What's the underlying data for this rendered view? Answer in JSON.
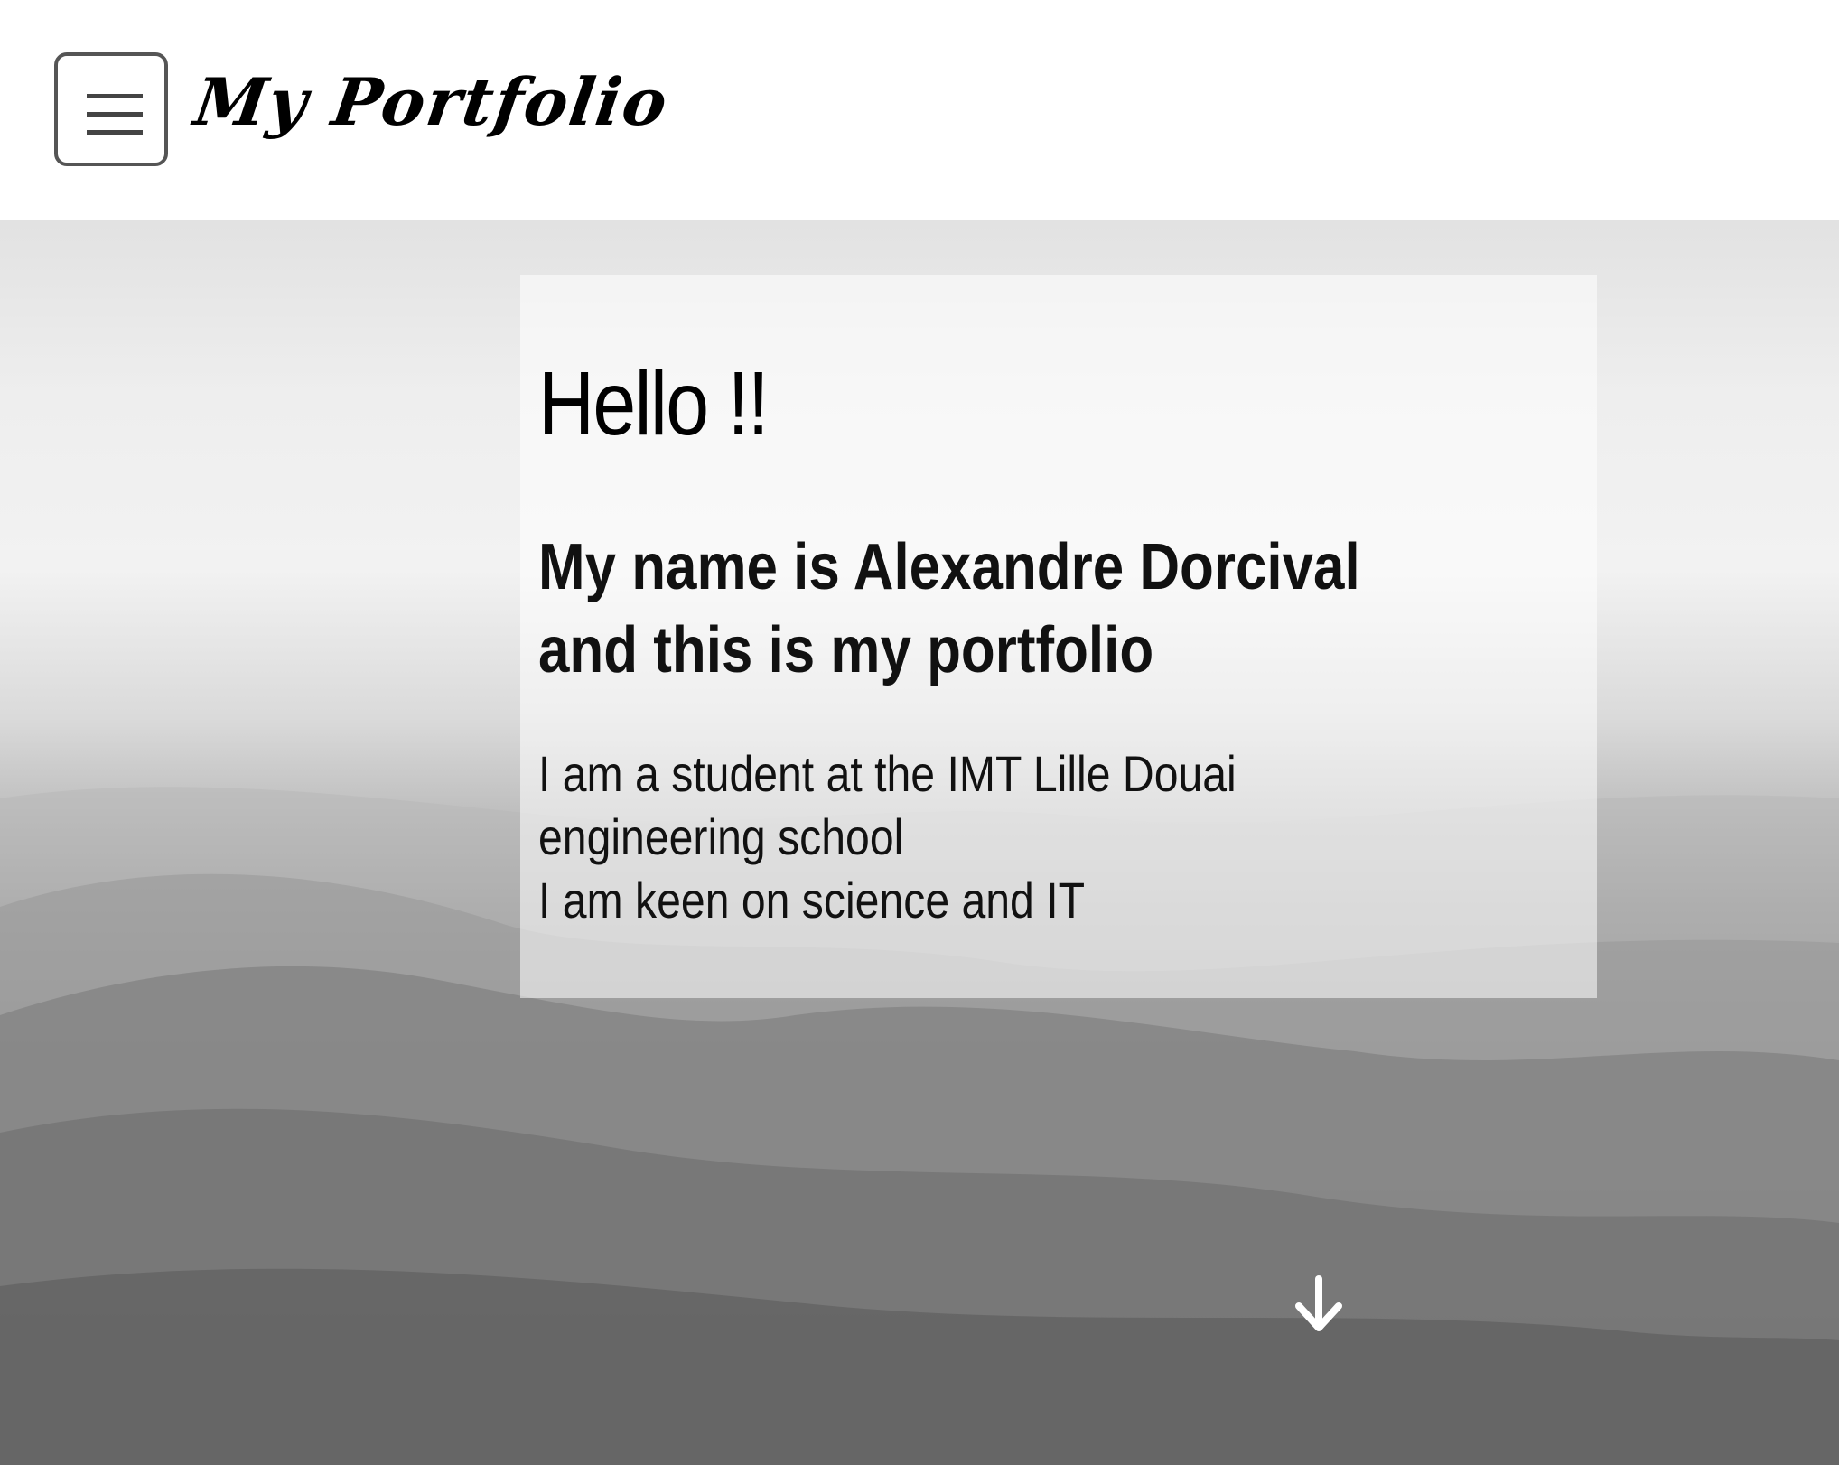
{
  "header": {
    "brand_title": "My Portfolio",
    "menu_icon": "hamburger-menu-icon"
  },
  "hero": {
    "greeting": "Hello !!",
    "subtitle": "My name is Alexandre Dorcival and this is my portfolio",
    "bio_lines": [
      "I am a student at the IMT Lille Douai engineering school",
      "I am keen on science and IT"
    ],
    "scroll_icon": "arrow-down-icon",
    "background_image": "grayscale hills landscape"
  },
  "colors": {
    "header_bg": "#ffffff",
    "text": "#000000",
    "menu_border": "#555555",
    "arrow": "#ffffff"
  }
}
